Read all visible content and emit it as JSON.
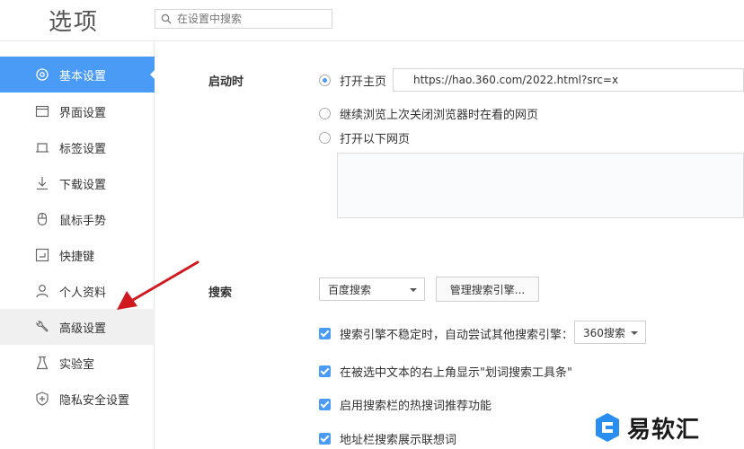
{
  "header": {
    "title": "选项",
    "search_placeholder": "在设置中搜索"
  },
  "sidebar": {
    "items": [
      {
        "label": "基本设置",
        "icon": "gear-icon",
        "active": true
      },
      {
        "label": "界面设置",
        "icon": "window-icon"
      },
      {
        "label": "标签设置",
        "icon": "tab-icon"
      },
      {
        "label": "下载设置",
        "icon": "download-icon"
      },
      {
        "label": "鼠标手势",
        "icon": "mouse-icon"
      },
      {
        "label": "快捷键",
        "icon": "shortcut-icon"
      },
      {
        "label": "个人资料",
        "icon": "user-icon"
      },
      {
        "label": "高级设置",
        "icon": "wrench-icon",
        "hover": true
      },
      {
        "label": "实验室",
        "icon": "flask-icon"
      },
      {
        "label": "隐私安全设置",
        "icon": "shield-icon"
      }
    ]
  },
  "startup": {
    "label": "启动时",
    "options": [
      {
        "label": "打开主页",
        "checked": true
      },
      {
        "label": "继续浏览上次关闭浏览器时在看的网页",
        "checked": false
      },
      {
        "label": "打开以下网页",
        "checked": false
      }
    ],
    "homepage_url": "https://hao.360.com/2022.html?src=x"
  },
  "search": {
    "label": "搜索",
    "engine_selected": "百度搜索",
    "manage_button": "管理搜索引擎...",
    "options": [
      {
        "label": "搜索引擎不稳定时，自动尝试其他搜索引擎：",
        "checked": true
      },
      {
        "label": "在被选中文本的右上角显示\"划词搜索工具条\"",
        "checked": true
      },
      {
        "label": "启用搜索栏的热搜词推荐功能",
        "checked": true
      },
      {
        "label": "地址栏搜索展示联想词",
        "checked": true
      }
    ],
    "fallback_engine": "360搜索"
  },
  "watermark": {
    "text": "易软汇"
  },
  "colors": {
    "accent": "#4a9bf5",
    "annotation_arrow": "#d0191f"
  }
}
